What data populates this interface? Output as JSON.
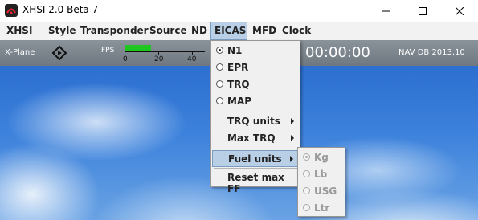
{
  "window": {
    "title": "XHSI 2.0 Beta 7"
  },
  "menubar": {
    "items": [
      {
        "label": "XHSI",
        "underline": "X"
      },
      {
        "label": "Style"
      },
      {
        "label": "Transponder"
      },
      {
        "label": "Source"
      },
      {
        "label": "ND"
      },
      {
        "label": "EICAS",
        "active": true
      },
      {
        "label": "MFD"
      },
      {
        "label": "Clock"
      }
    ]
  },
  "infobar": {
    "source": "X-Plane",
    "fps_label": "FPS",
    "fps_ticks": [
      "0",
      "20",
      "40"
    ],
    "fps_fill_fraction": 0.2,
    "clock": "00:00:00",
    "nav_db": "NAV DB 2013.10"
  },
  "eicas_menu": {
    "engine_options": [
      "N1",
      "EPR",
      "TRQ",
      "MAP"
    ],
    "selected_engine": "N1",
    "trq_units": "TRQ units",
    "max_trq": "Max TRQ",
    "fuel_units": "Fuel units",
    "reset_max_ff": "Reset max FF"
  },
  "fuel_units_submenu": {
    "options": [
      "Kg",
      "Lb",
      "USG",
      "Ltr"
    ],
    "selected": "Kg",
    "enabled": false
  },
  "colors": {
    "menu_highlight": "#b8cfe5",
    "fps_bar": "#1fc61f",
    "infobar": "#7b838b"
  }
}
